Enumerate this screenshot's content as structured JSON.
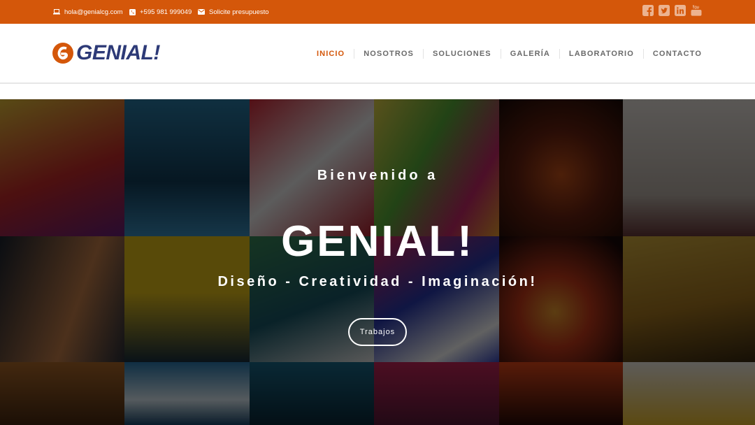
{
  "topbar": {
    "email": "hola@genialcg.com",
    "phone": "+595 981 999049",
    "quote": "Solicite presupuesto",
    "social": [
      "facebook-icon",
      "twitter-icon",
      "linkedin-icon",
      "youtube-icon"
    ]
  },
  "header": {
    "logo_text": "GENIAL!",
    "nav": [
      "INICIO",
      "NOSOTROS",
      "SOLUCIONES",
      "GALERÍA",
      "LABORATORIO",
      "CONTACTO"
    ]
  },
  "hero": {
    "welcome": "Bienvenido a",
    "title": "GENIAL!",
    "tagline": "Diseño - Creatividad - Imaginación!",
    "button": "Trabajos"
  },
  "colors": {
    "brand_orange": "#d4570a",
    "brand_navy": "#2d3a77"
  }
}
